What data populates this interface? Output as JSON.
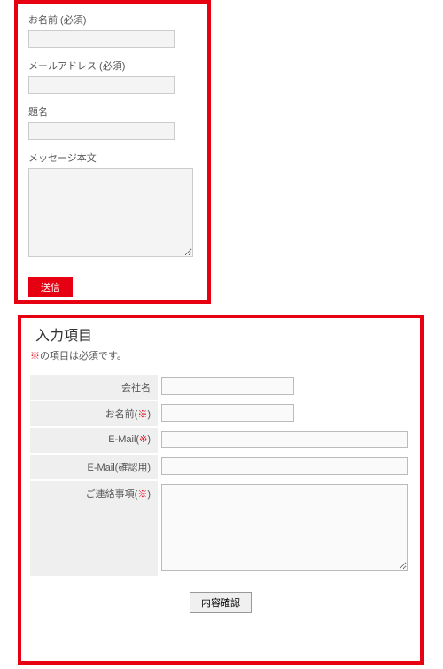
{
  "form1": {
    "name": {
      "label": "お名前 (必須)",
      "value": ""
    },
    "email": {
      "label": "メールアドレス (必須)",
      "value": ""
    },
    "subject": {
      "label": "題名",
      "value": ""
    },
    "message": {
      "label": "メッセージ本文",
      "value": ""
    },
    "submit": "送信"
  },
  "form2": {
    "heading": "入力項目",
    "note_prefix": "※",
    "note_text": "の項目は必須です。",
    "fields": {
      "company": {
        "label": "会社名",
        "value": ""
      },
      "name": {
        "label": "お名前(",
        "req": "※",
        "label_close": ")",
        "value": ""
      },
      "email": {
        "label": "E-Mail(",
        "req": "※",
        "label_close": ")",
        "value": ""
      },
      "email_confirm": {
        "label": "E-Mail(確認用)",
        "value": ""
      },
      "message": {
        "label": "ご連絡事項(",
        "req": "※",
        "label_close": ")",
        "value": ""
      }
    },
    "confirm": "内容確認"
  }
}
